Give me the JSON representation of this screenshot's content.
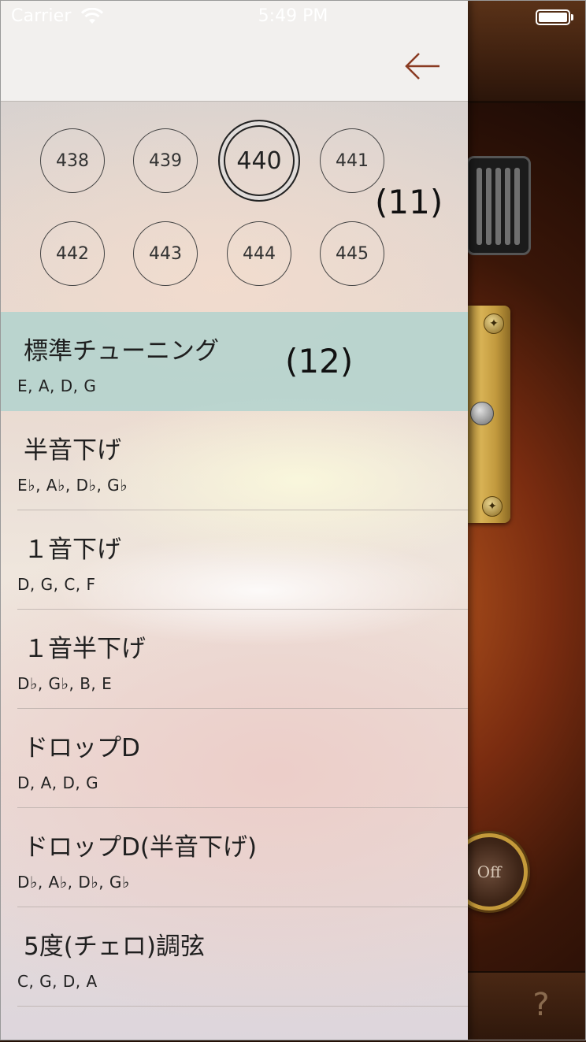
{
  "status_bar": {
    "carrier": "Carrier",
    "time": "5:49 PM"
  },
  "frequencies": {
    "row1": [
      "438",
      "439",
      "440",
      "441"
    ],
    "row2": [
      "442",
      "443",
      "444",
      "445"
    ],
    "selected": "440"
  },
  "annotations": {
    "frequency_group": "(11)",
    "tuning_list": "(12)"
  },
  "tunings": [
    {
      "name": "標準チューニング",
      "notes": "E, A, D, G",
      "selected": true
    },
    {
      "name": "半音下げ",
      "notes": "E♭, A♭, D♭, G♭"
    },
    {
      "name": "１音下げ",
      "notes": "D, G, C, F"
    },
    {
      "name": "１音半下げ",
      "notes": "D♭, G♭, B, E"
    },
    {
      "name": "ドロップD",
      "notes": "D, A, D, G"
    },
    {
      "name": "ドロップD(半音下げ)",
      "notes": "D♭, A♭, D♭, G♭"
    },
    {
      "name": "5度(チェロ)調弦",
      "notes": "C, G, D, A"
    }
  ],
  "background_app": {
    "off_label": "Off",
    "help_label": "?"
  },
  "colors": {
    "back_arrow": "#8a3b22",
    "selected_row": "#aad2cd"
  }
}
